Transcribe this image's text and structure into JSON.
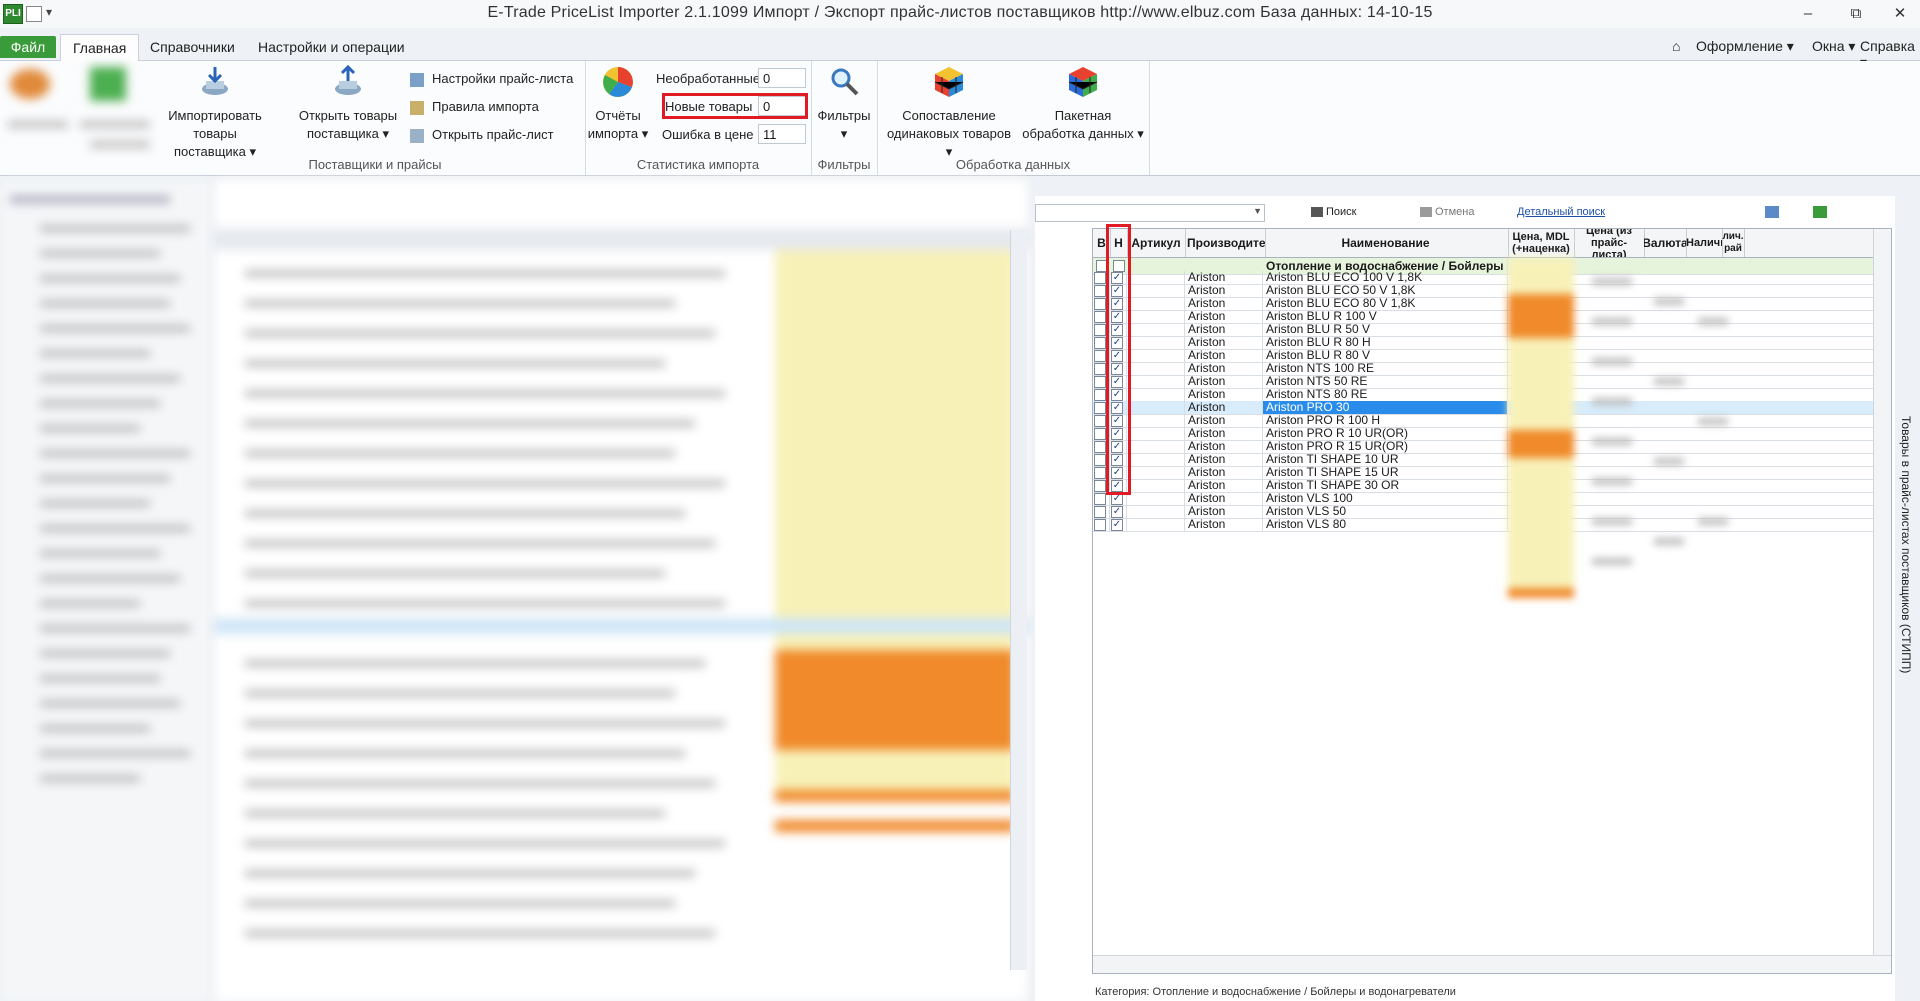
{
  "window": {
    "title": "E-Trade PriceList Importer 2.1.1099     Импорт / Экспорт прайс-листов поставщиков     http://www.elbuz.com     База данных: 14-10-15",
    "app_icon": "PLI",
    "minimize": "–",
    "maximize": "⧉",
    "close": "✕"
  },
  "tabs": {
    "file": "Файл",
    "items": [
      "Главная",
      "Справочники",
      "Настройки и операции"
    ],
    "right": [
      "Оформление",
      "Окна",
      "Справка"
    ]
  },
  "ribbon": {
    "groups": {
      "suppliers": "Поставщики и прайсы",
      "stats": "Статистика импорта",
      "filters": "Фильтры",
      "processing": "Обработка данных"
    },
    "import_btn": [
      "Импортировать",
      "товары поставщика"
    ],
    "open_btn": [
      "Открыть товары",
      "поставщика"
    ],
    "small": [
      "Настройки прайс-листа",
      "Правила импорта",
      "Открыть прайс-лист"
    ],
    "reports_btn": [
      "Отчёты",
      "импорта"
    ],
    "stats": [
      {
        "label": "Необработанные",
        "value": "0"
      },
      {
        "label": "Новые товары",
        "value": "0"
      },
      {
        "label": "Ошибка в цене",
        "value": "11"
      }
    ],
    "filters_btn": [
      "Фильтры"
    ],
    "compare_btn": [
      "Сопоставление",
      "одинаковых товаров"
    ],
    "batch_btn": [
      "Пакетная",
      "обработка данных"
    ]
  },
  "right_panel": {
    "search": "Поиск",
    "cancel": "Отмена",
    "detailed": "Детальный поиск",
    "side_title": "Товары в прайс-листах поставщиков (СТИПП)",
    "category": "Категория: Отопление и водоснабжение / Бойлеры и водонагреватели"
  },
  "grid": {
    "headers": [
      "В",
      "Н",
      "Артикул",
      "Производитель",
      "Наименование",
      "Цена, MDL (+наценка)",
      "Цена (из прайс-листа)",
      "Валюта",
      "Наличие",
      "лич. рай"
    ],
    "group": "Отопление и водоснабжение / Бойлеры и водонагреватели",
    "rows": [
      {
        "maker": "Ariston",
        "name": "Ariston BLU ECO 100 V 1,8K",
        "v": false,
        "n": true
      },
      {
        "maker": "Ariston",
        "name": "Ariston BLU ECO 50 V 1,8K",
        "v": false,
        "n": true
      },
      {
        "maker": "Ariston",
        "name": "Ariston BLU ECO 80 V 1,8K",
        "v": false,
        "n": true
      },
      {
        "maker": "Ariston",
        "name": "Ariston BLU R 100 V",
        "v": false,
        "n": true
      },
      {
        "maker": "Ariston",
        "name": "Ariston BLU R 50 V",
        "v": false,
        "n": true
      },
      {
        "maker": "Ariston",
        "name": "Ariston BLU R 80 H",
        "v": false,
        "n": true
      },
      {
        "maker": "Ariston",
        "name": "Ariston BLU R 80 V",
        "v": false,
        "n": true
      },
      {
        "maker": "Ariston",
        "name": "Ariston NTS 100 RE",
        "v": false,
        "n": true
      },
      {
        "maker": "Ariston",
        "name": "Ariston NTS 50 RE",
        "v": false,
        "n": true
      },
      {
        "maker": "Ariston",
        "name": "Ariston NTS 80 RE",
        "v": false,
        "n": true
      },
      {
        "maker": "Ariston",
        "name": "Ariston PRO 30",
        "v": false,
        "n": true,
        "selected": true
      },
      {
        "maker": "Ariston",
        "name": "Ariston PRO R 100 H",
        "v": false,
        "n": true
      },
      {
        "maker": "Ariston",
        "name": "Ariston PRO R 10 UR(OR)",
        "v": false,
        "n": true
      },
      {
        "maker": "Ariston",
        "name": "Ariston PRO R 15 UR(OR)",
        "v": false,
        "n": true
      },
      {
        "maker": "Ariston",
        "name": "Ariston TI SHAPE 10 UR",
        "v": false,
        "n": true
      },
      {
        "maker": "Ariston",
        "name": "Ariston TI SHAPE 15 UR",
        "v": false,
        "n": true
      },
      {
        "maker": "Ariston",
        "name": "Ariston TI SHAPE 30 OR",
        "v": false,
        "n": true
      },
      {
        "maker": "Ariston",
        "name": "Ariston VLS 100",
        "v": false,
        "n": true
      },
      {
        "maker": "Ariston",
        "name": "Ariston VLS 50",
        "v": false,
        "n": true
      },
      {
        "maker": "Ariston",
        "name": "Ariston VLS 80",
        "v": false,
        "n": true
      }
    ]
  },
  "colors": {
    "accent_green": "#3a9b3a",
    "highlight_red": "#e01b24",
    "selected_row": "#2a8cea",
    "price_yellow": "#f7f1b8",
    "price_orange": "#f08a2a"
  }
}
